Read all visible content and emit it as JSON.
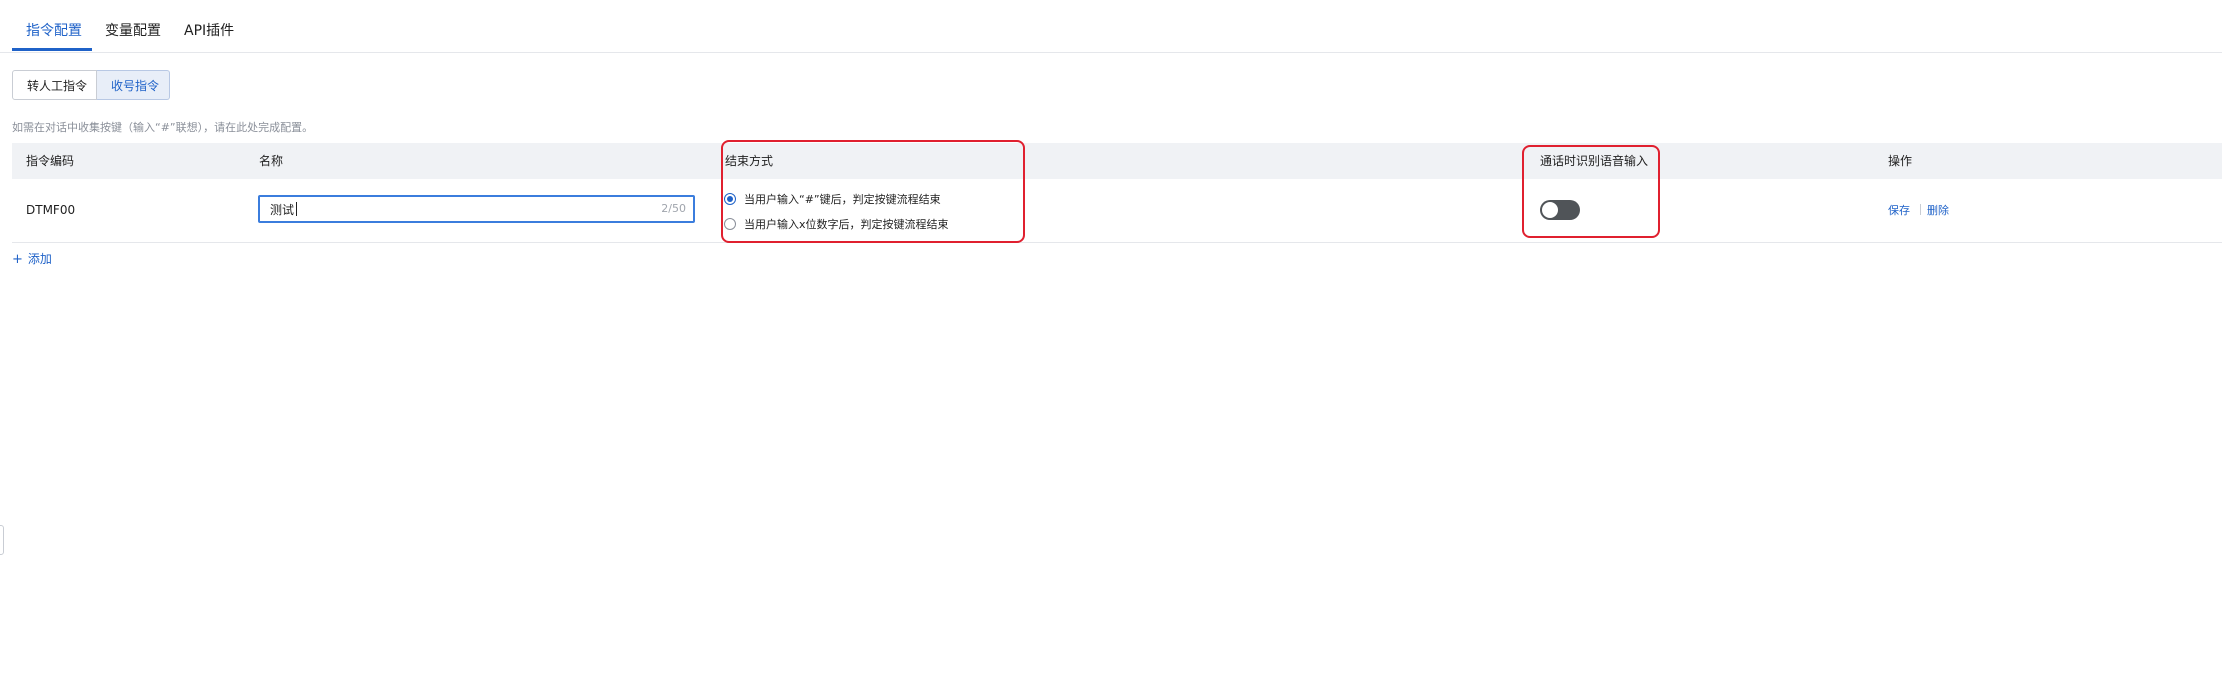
{
  "tabs": [
    {
      "label": "指令配置",
      "active": true
    },
    {
      "label": "变量配置",
      "active": false
    },
    {
      "label": "API插件",
      "active": false
    }
  ],
  "segment": {
    "options": [
      "转人工指令",
      "收号指令"
    ],
    "selected": "收号指令"
  },
  "hint": "如需在对话中收集按键（输入“#”联想），请在此处完成配置。",
  "table": {
    "headers": {
      "code": "指令编码",
      "name": "名称",
      "end_mode": "结束方式",
      "voice_input": "通话时识别语音输入",
      "actions": "操作"
    },
    "rows": [
      {
        "code": "DTMF00",
        "name_value": "测试",
        "name_counter": "2/50",
        "end_options": [
          {
            "label": "当用户输入“#”键后，判定按键流程结束",
            "checked": true
          },
          {
            "label": "当用户输入x位数字后，判定按键流程结束",
            "checked": false
          }
        ],
        "voice_input_enabled": false,
        "actions": {
          "save": "保存",
          "delete": "删除"
        }
      }
    ]
  },
  "add_label": "添加",
  "colors": {
    "accent": "#1f62c8",
    "highlight": "#e0202f",
    "header_bg": "#f0f2f5",
    "toggle_off": "#505458"
  },
  "icons": {
    "add": "plus-icon"
  }
}
